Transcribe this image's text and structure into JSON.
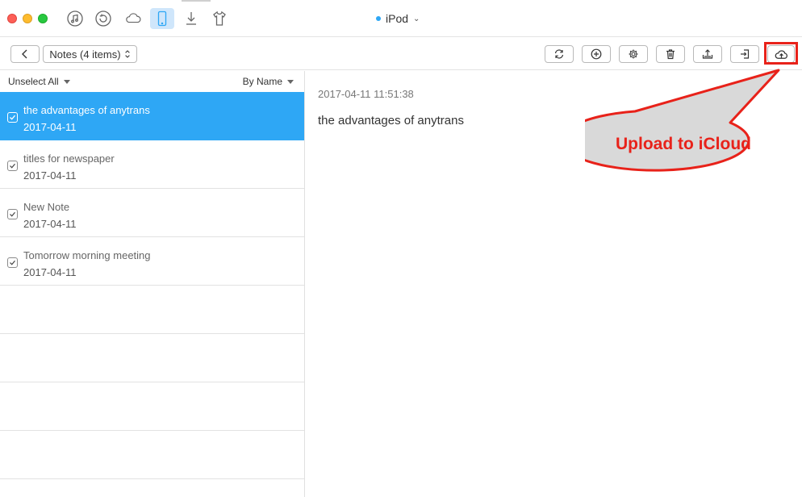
{
  "titlebar": {
    "device_name": "iPod",
    "top_icons": [
      "itunes-library-icon",
      "backup-restore-icon",
      "icloud-icon",
      "device-icon",
      "download-icon",
      "ringtone-shirt-icon"
    ],
    "active_icon": "device-icon",
    "accent_color": "#2ea7f5"
  },
  "toolbar": {
    "category_label": "Notes (4 items)",
    "actions": [
      "refresh",
      "add",
      "settings",
      "delete",
      "send-to-device",
      "export-to-computer",
      "upload-to-icloud"
    ]
  },
  "list": {
    "unselect_label": "Unselect All",
    "sort_label": "By Name",
    "items": [
      {
        "title": "the advantages of anytrans",
        "date": "2017-04-11",
        "selected": true,
        "checked": true
      },
      {
        "title": "titles for newspaper",
        "date": "2017-04-11",
        "selected": false,
        "checked": true
      },
      {
        "title": "New Note",
        "date": "2017-04-11",
        "selected": false,
        "checked": true
      },
      {
        "title": "Tomorrow morning meeting",
        "date": "2017-04-11",
        "selected": false,
        "checked": true
      }
    ]
  },
  "detail": {
    "timestamp": "2017-04-11 11:51:38",
    "body": "the advantages of anytrans"
  },
  "annotation": {
    "label": "Upload to iCloud",
    "color": "#e8221a"
  }
}
